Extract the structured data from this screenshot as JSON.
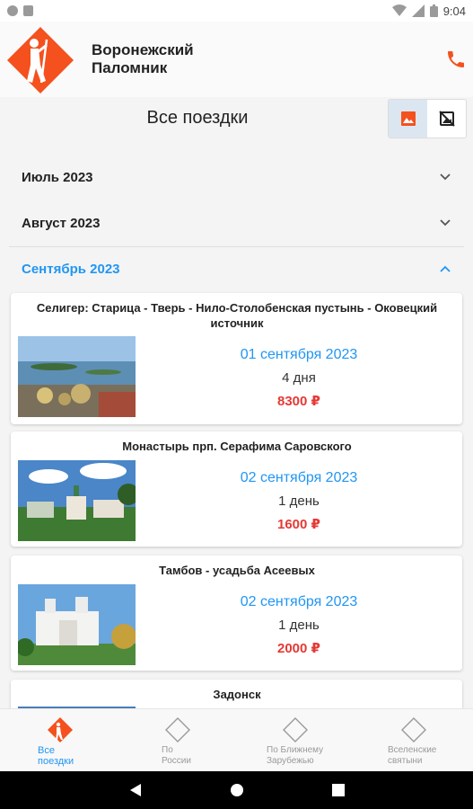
{
  "status_bar": {
    "time": "9:04"
  },
  "header": {
    "brand_line1": "Воронежский",
    "brand_line2": "Паломник"
  },
  "title": "Все поездки",
  "months": [
    {
      "label": "Июль 2023",
      "expanded": false
    },
    {
      "label": "Август 2023",
      "expanded": false
    },
    {
      "label": "Сентябрь 2023",
      "expanded": true
    }
  ],
  "trips": [
    {
      "title": "Селигер: Старица - Тверь - Нило-Столобенская пустынь - Оковецкий источник",
      "date": "01 сентября 2023",
      "duration": "4 дня",
      "price": "8300 ₽"
    },
    {
      "title": "Монастырь прп. Серафима Саровского",
      "date": "02 сентября 2023",
      "duration": "1 день",
      "price": "1600 ₽"
    },
    {
      "title": "Тамбов - усадьба Асеевых",
      "date": "02 сентября 2023",
      "duration": "1 день",
      "price": "2000 ₽"
    },
    {
      "title": "Задонск"
    }
  ],
  "bottom_nav": [
    {
      "line1": "Все",
      "line2": "поездки",
      "icon": "pilgrim-logo-icon",
      "active": true
    },
    {
      "line1": "По",
      "line2": "России",
      "icon": "diamond-icon",
      "active": false
    },
    {
      "line1": "По Ближнему",
      "line2": "Зарубежью",
      "icon": "diamond-icon",
      "active": false
    },
    {
      "line1": "Вселенские",
      "line2": "святыни",
      "icon": "diamond-icon",
      "active": false
    }
  ],
  "colors": {
    "accent": "#2196f3",
    "brand": "#f4511e",
    "price": "#e53935"
  }
}
